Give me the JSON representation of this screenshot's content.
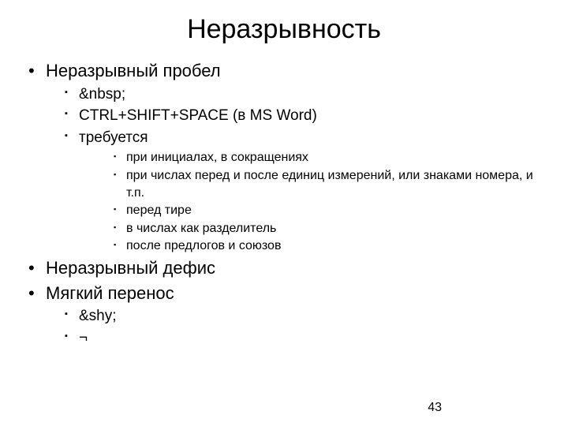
{
  "title": "Неразрывность",
  "items": [
    {
      "label": "Неразрывный пробел",
      "sub": [
        {
          "label": "&nbsp;"
        },
        {
          "label": "CTRL+SHIFT+SPACE (в MS Word)"
        },
        {
          "label": "требуется",
          "sub": [
            "при инициалах, в сокращениях",
            "при числах перед и после единиц измерений, или знаками номера, и т.п.",
            "перед тире",
            "в числах как разделитель",
            "после предлогов и союзов"
          ]
        }
      ]
    },
    {
      "label": "Неразрывный дефис"
    },
    {
      "label": "Мягкий перенос",
      "sub": [
        {
          "label": "&shy;"
        },
        {
          "label": "¬"
        }
      ]
    }
  ],
  "page_number": "43"
}
